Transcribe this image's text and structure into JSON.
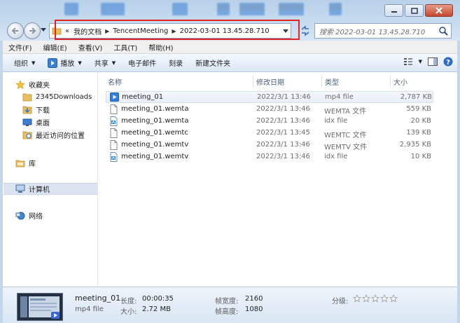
{
  "titlebar": {
    "blur_labels": [
      "排列",
      "迭进程式",
      "刷新程序",
      "选择"
    ]
  },
  "address": {
    "crumbs": [
      "我的文档",
      "TencentMeeting",
      "2022-03-01 13.45.28.710"
    ],
    "overflow": "«"
  },
  "search": {
    "placeholder": "搜索 2022-03-01 13.45.28.710"
  },
  "menu": {
    "items": [
      "文件(F)",
      "编辑(E)",
      "查看(V)",
      "工具(T)",
      "帮助(H)"
    ]
  },
  "toolbar": {
    "organize": "组织",
    "play": "播放",
    "share": "共享",
    "email": "电子邮件",
    "burn": "刻录",
    "new_folder": "新建文件夹"
  },
  "nav": {
    "favorites": "收藏夹",
    "downloads2345": "2345Downloads",
    "downloads": "下载",
    "desktop": "桌面",
    "recent": "最近访问的位置",
    "libraries": "库",
    "computer": "计算机",
    "network": "网络"
  },
  "columns": {
    "name": "名称",
    "date": "修改日期",
    "type": "类型",
    "size": "大小"
  },
  "files": [
    {
      "name": "meeting_01",
      "date": "2022/3/1 13:46",
      "type": "mp4 file",
      "size": "2,787 KB",
      "icon": "video-icon"
    },
    {
      "name": "meeting_01.wemta",
      "date": "2022/3/1 13:46",
      "type": "WEMTA 文件",
      "size": "559 KB",
      "icon": "file-icon"
    },
    {
      "name": "meeting_01.wemta",
      "date": "2022/3/1 13:46",
      "type": "idx file",
      "size": "20 KB",
      "icon": "idx-file-icon"
    },
    {
      "name": "meeting_01.wemtc",
      "date": "2022/3/1 13:45",
      "type": "WEMTC 文件",
      "size": "139 KB",
      "icon": "file-icon"
    },
    {
      "name": "meeting_01.wemtv",
      "date": "2022/3/1 13:46",
      "type": "WEMTV 文件",
      "size": "2,935 KB",
      "icon": "file-icon"
    },
    {
      "name": "meeting_01.wemtv",
      "date": "2022/3/1 13:46",
      "type": "idx file",
      "size": "10 KB",
      "icon": "idx-file-icon"
    }
  ],
  "details": {
    "name": "meeting_01",
    "type": "mp4 file",
    "length_key": "长度:",
    "length_val": "00:00:35",
    "size_key": "大小:",
    "size_val": "2.72 MB",
    "width_key": "帧宽度:",
    "width_val": "2160",
    "height_key": "帧高度:",
    "height_val": "1080",
    "rating_key": "分级:",
    "rating_stars": 0
  },
  "colors": {
    "highlight": "#e32222",
    "accent": "#3c7fd1"
  }
}
